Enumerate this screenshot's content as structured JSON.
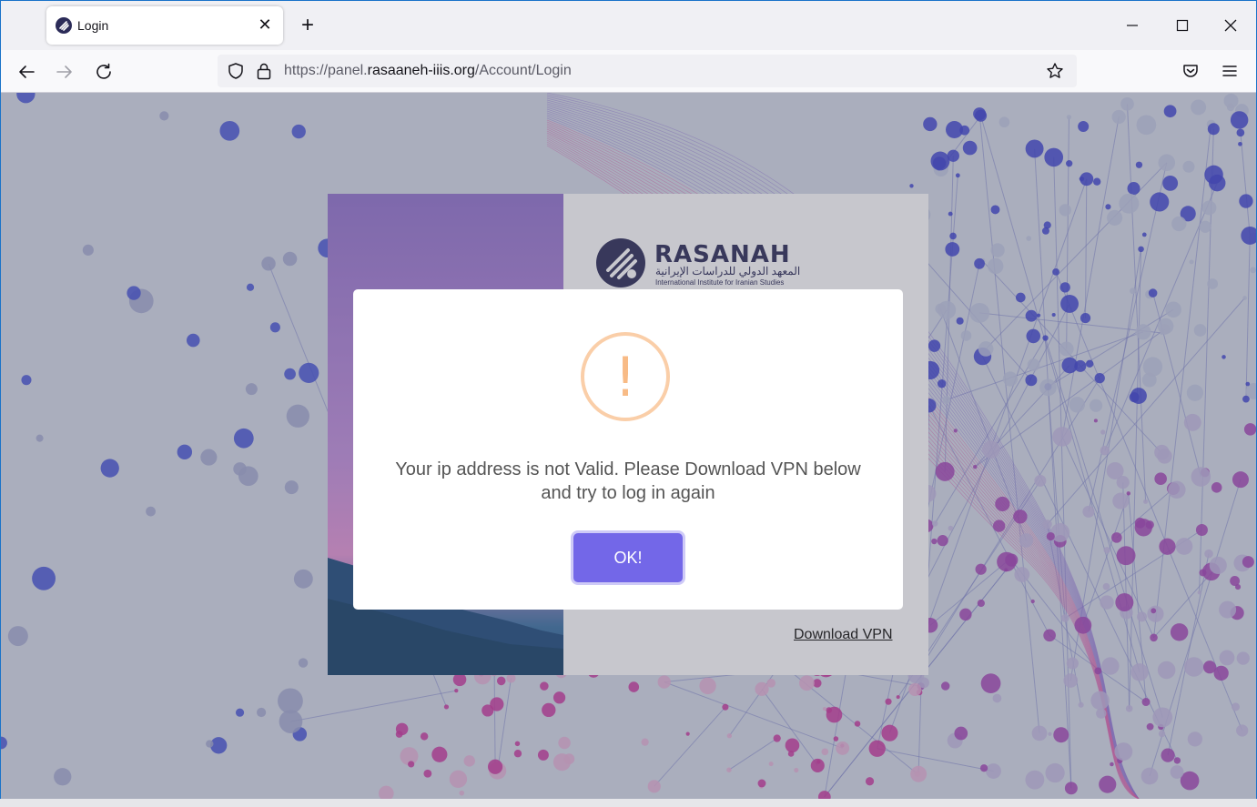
{
  "browser": {
    "tab_title": "Login",
    "url_prefix": "https://panel.",
    "url_domain": "rasaaneh-iiis.org",
    "url_path": "/Account/Login"
  },
  "brand": {
    "wordmark": "RASANAH",
    "arabic_name": "المعهد الدولي للدراسات الإيرانية",
    "tagline": "International Institute for Iranian Studies"
  },
  "page": {
    "download_vpn_link": "Download VPN"
  },
  "dialog": {
    "icon_glyph": "!",
    "message": "Your ip address is not Valid. Please Download VPN below and try to log in again",
    "ok_label": "OK!"
  },
  "colors": {
    "accent": "#7367e8",
    "warning": "#f8bb86",
    "warning_ring": "#facea8",
    "browser_chrome": "#f0f0f4"
  }
}
